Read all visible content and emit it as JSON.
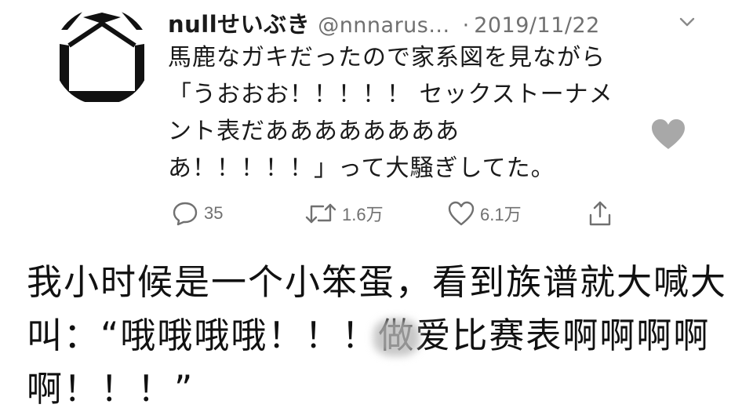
{
  "tweet": {
    "display_name": "nullせいぶき",
    "handle": "@nnnarus...",
    "separator": "·",
    "date": "2019/11/22",
    "lines": [
      "馬鹿なガキだったので家系図を見ながら",
      "「うおおお！！！！！ セックストーナメ",
      "ント表だああああああああ",
      "あ！！！！！」って大騒ぎしてた。"
    ],
    "actions": {
      "reply_count": "35",
      "retweet_count": "1.6万",
      "like_count": "6.1万"
    }
  },
  "caption": {
    "line1": "我小时候是一个小笨蛋，看到族谱就大喊大",
    "line2_before": "叫：“哦哦哦哦！！！",
    "line2_smudged": "做",
    "line2_after": "爱比赛表啊啊啊啊",
    "line3": "啊！！！”"
  },
  "colors": {
    "text": "#1a1a1a",
    "muted": "#707070",
    "heart": "#a8a8a8"
  }
}
